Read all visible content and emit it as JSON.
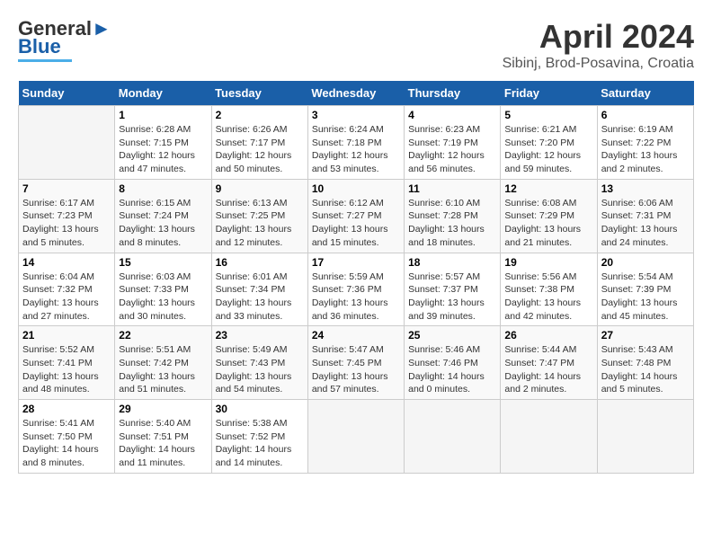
{
  "header": {
    "logo_line1": "General",
    "logo_line2": "Blue",
    "month_title": "April 2024",
    "subtitle": "Sibinj, Brod-Posavina, Croatia"
  },
  "days_of_week": [
    "Sunday",
    "Monday",
    "Tuesday",
    "Wednesday",
    "Thursday",
    "Friday",
    "Saturday"
  ],
  "weeks": [
    [
      {
        "num": "",
        "info": ""
      },
      {
        "num": "1",
        "info": "Sunrise: 6:28 AM\nSunset: 7:15 PM\nDaylight: 12 hours\nand 47 minutes."
      },
      {
        "num": "2",
        "info": "Sunrise: 6:26 AM\nSunset: 7:17 PM\nDaylight: 12 hours\nand 50 minutes."
      },
      {
        "num": "3",
        "info": "Sunrise: 6:24 AM\nSunset: 7:18 PM\nDaylight: 12 hours\nand 53 minutes."
      },
      {
        "num": "4",
        "info": "Sunrise: 6:23 AM\nSunset: 7:19 PM\nDaylight: 12 hours\nand 56 minutes."
      },
      {
        "num": "5",
        "info": "Sunrise: 6:21 AM\nSunset: 7:20 PM\nDaylight: 12 hours\nand 59 minutes."
      },
      {
        "num": "6",
        "info": "Sunrise: 6:19 AM\nSunset: 7:22 PM\nDaylight: 13 hours\nand 2 minutes."
      }
    ],
    [
      {
        "num": "7",
        "info": "Sunrise: 6:17 AM\nSunset: 7:23 PM\nDaylight: 13 hours\nand 5 minutes."
      },
      {
        "num": "8",
        "info": "Sunrise: 6:15 AM\nSunset: 7:24 PM\nDaylight: 13 hours\nand 8 minutes."
      },
      {
        "num": "9",
        "info": "Sunrise: 6:13 AM\nSunset: 7:25 PM\nDaylight: 13 hours\nand 12 minutes."
      },
      {
        "num": "10",
        "info": "Sunrise: 6:12 AM\nSunset: 7:27 PM\nDaylight: 13 hours\nand 15 minutes."
      },
      {
        "num": "11",
        "info": "Sunrise: 6:10 AM\nSunset: 7:28 PM\nDaylight: 13 hours\nand 18 minutes."
      },
      {
        "num": "12",
        "info": "Sunrise: 6:08 AM\nSunset: 7:29 PM\nDaylight: 13 hours\nand 21 minutes."
      },
      {
        "num": "13",
        "info": "Sunrise: 6:06 AM\nSunset: 7:31 PM\nDaylight: 13 hours\nand 24 minutes."
      }
    ],
    [
      {
        "num": "14",
        "info": "Sunrise: 6:04 AM\nSunset: 7:32 PM\nDaylight: 13 hours\nand 27 minutes."
      },
      {
        "num": "15",
        "info": "Sunrise: 6:03 AM\nSunset: 7:33 PM\nDaylight: 13 hours\nand 30 minutes."
      },
      {
        "num": "16",
        "info": "Sunrise: 6:01 AM\nSunset: 7:34 PM\nDaylight: 13 hours\nand 33 minutes."
      },
      {
        "num": "17",
        "info": "Sunrise: 5:59 AM\nSunset: 7:36 PM\nDaylight: 13 hours\nand 36 minutes."
      },
      {
        "num": "18",
        "info": "Sunrise: 5:57 AM\nSunset: 7:37 PM\nDaylight: 13 hours\nand 39 minutes."
      },
      {
        "num": "19",
        "info": "Sunrise: 5:56 AM\nSunset: 7:38 PM\nDaylight: 13 hours\nand 42 minutes."
      },
      {
        "num": "20",
        "info": "Sunrise: 5:54 AM\nSunset: 7:39 PM\nDaylight: 13 hours\nand 45 minutes."
      }
    ],
    [
      {
        "num": "21",
        "info": "Sunrise: 5:52 AM\nSunset: 7:41 PM\nDaylight: 13 hours\nand 48 minutes."
      },
      {
        "num": "22",
        "info": "Sunrise: 5:51 AM\nSunset: 7:42 PM\nDaylight: 13 hours\nand 51 minutes."
      },
      {
        "num": "23",
        "info": "Sunrise: 5:49 AM\nSunset: 7:43 PM\nDaylight: 13 hours\nand 54 minutes."
      },
      {
        "num": "24",
        "info": "Sunrise: 5:47 AM\nSunset: 7:45 PM\nDaylight: 13 hours\nand 57 minutes."
      },
      {
        "num": "25",
        "info": "Sunrise: 5:46 AM\nSunset: 7:46 PM\nDaylight: 14 hours\nand 0 minutes."
      },
      {
        "num": "26",
        "info": "Sunrise: 5:44 AM\nSunset: 7:47 PM\nDaylight: 14 hours\nand 2 minutes."
      },
      {
        "num": "27",
        "info": "Sunrise: 5:43 AM\nSunset: 7:48 PM\nDaylight: 14 hours\nand 5 minutes."
      }
    ],
    [
      {
        "num": "28",
        "info": "Sunrise: 5:41 AM\nSunset: 7:50 PM\nDaylight: 14 hours\nand 8 minutes."
      },
      {
        "num": "29",
        "info": "Sunrise: 5:40 AM\nSunset: 7:51 PM\nDaylight: 14 hours\nand 11 minutes."
      },
      {
        "num": "30",
        "info": "Sunrise: 5:38 AM\nSunset: 7:52 PM\nDaylight: 14 hours\nand 14 minutes."
      },
      {
        "num": "",
        "info": ""
      },
      {
        "num": "",
        "info": ""
      },
      {
        "num": "",
        "info": ""
      },
      {
        "num": "",
        "info": ""
      }
    ]
  ]
}
